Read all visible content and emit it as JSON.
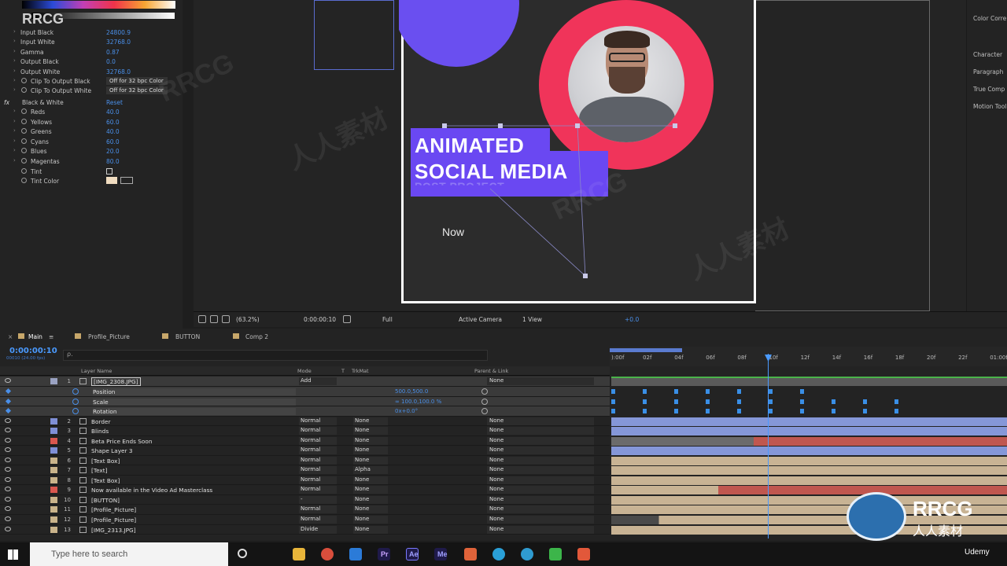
{
  "watermark": {
    "brand": "RRCG",
    "sub": "人人素材",
    "diag1": "人人素材",
    "diag2": "RRCG",
    "udemy": "Udemy"
  },
  "effects": {
    "levels_props": [
      {
        "name": "Input Black",
        "value": "24800.9"
      },
      {
        "name": "Input White",
        "value": "32768.0"
      },
      {
        "name": "Gamma",
        "value": "0.87"
      },
      {
        "name": "Output Black",
        "value": "0.0"
      },
      {
        "name": "Output White",
        "value": "32768.0"
      },
      {
        "name": "Clip To Output Black",
        "value": "Off for 32 bpc Color"
      },
      {
        "name": "Clip To Output White",
        "value": "Off for 32 bpc Color"
      }
    ],
    "bw_title": "Black & White",
    "bw_reset": "Reset",
    "bw_props": [
      {
        "name": "Reds",
        "value": "40.0"
      },
      {
        "name": "Yellows",
        "value": "60.0"
      },
      {
        "name": "Greens",
        "value": "40.0"
      },
      {
        "name": "Cyans",
        "value": "60.0"
      },
      {
        "name": "Blues",
        "value": "20.0"
      },
      {
        "name": "Magentas",
        "value": "80.0"
      },
      {
        "name": "Tint",
        "value": ""
      },
      {
        "name": "Tint Color",
        "value": ""
      }
    ]
  },
  "artwork": {
    "line1": "ANIMATED",
    "line2": "SOCIAL MEDIA",
    "line3": "POST PROJECT",
    "now": "Now"
  },
  "right_panel": {
    "color_corr": "Color Corre",
    "items": [
      "Character",
      "Paragraph",
      "True Comp",
      "Motion Tool"
    ]
  },
  "viewer_bar": {
    "zoom": "(63.2%)",
    "time": "0:00:00:10",
    "res": "Full",
    "camera": "Active Camera",
    "view": "1 View",
    "exposure": "+0.0"
  },
  "tabs": [
    "Main",
    "Profile_Picture",
    "BUTTON",
    "Comp 2"
  ],
  "timecode": "0:00:00:10",
  "timecode_sub": "00010 (24.00 fps)",
  "search_placeholder": "ρ.",
  "headers": {
    "layer": "Layer Name",
    "mode": "Mode",
    "t": "T",
    "trkmat": "TrkMat",
    "parent": "Parent & Link"
  },
  "ruler": [
    "):00f",
    "02f",
    "04f",
    "06f",
    "08f",
    "10f",
    "12f",
    "14f",
    "16f",
    "18f",
    "20f",
    "22f",
    "01:00f"
  ],
  "selected_layer": {
    "num": "1",
    "name": "[IMG_2308.JPG]",
    "mode": "Add",
    "parent": "None"
  },
  "transform": [
    {
      "name": "Position",
      "value": "500.0,500.0"
    },
    {
      "name": "Scale",
      "value": "∞ 100.0,100.0 %"
    },
    {
      "name": "Rotation",
      "value": "0x+0.0°"
    }
  ],
  "layers": [
    {
      "num": "2",
      "name": "Border",
      "mode": "Normal",
      "trk": "None",
      "parent": "None",
      "color": "#7f8fd6",
      "bar": "#8597d8"
    },
    {
      "num": "3",
      "name": "Blinds",
      "mode": "Normal",
      "trk": "None",
      "parent": "None",
      "color": "#7f8fd6",
      "bar": "#8597d8"
    },
    {
      "num": "4",
      "name": "Beta Price Ends Soon",
      "mode": "Normal",
      "trk": "None",
      "parent": "None",
      "color": "#d9574f",
      "bar": "#c0574f"
    },
    {
      "num": "5",
      "name": "Shape Layer 3",
      "mode": "Normal",
      "trk": "None",
      "parent": "None",
      "color": "#7f8fd6",
      "bar": "#8597d8"
    },
    {
      "num": "6",
      "name": "[Text Box]",
      "mode": "Normal",
      "trk": "None",
      "parent": "None",
      "color": "#c9b38a",
      "bar": "#c8b394"
    },
    {
      "num": "7",
      "name": "[Text]",
      "mode": "Normal",
      "trk": "Alpha",
      "parent": "None",
      "color": "#c9b38a",
      "bar": "#c8b394"
    },
    {
      "num": "8",
      "name": "[Text Box]",
      "mode": "Normal",
      "trk": "None",
      "parent": "None",
      "color": "#c9b38a",
      "bar": "#c8b394"
    },
    {
      "num": "9",
      "name": "Now available in the Video Ad Masterclass",
      "mode": "Normal",
      "trk": "None",
      "parent": "None",
      "color": "#d9574f",
      "bar": "#c0574f"
    },
    {
      "num": "10",
      "name": "[BUTTON]",
      "mode": "-",
      "trk": "None",
      "parent": "None",
      "color": "#c9b38a",
      "bar": "#c8b394"
    },
    {
      "num": "11",
      "name": "[Profile_Picture]",
      "mode": "Normal",
      "trk": "None",
      "parent": "None",
      "color": "#c9b38a",
      "bar": "#c8b394"
    },
    {
      "num": "12",
      "name": "[Profile_Picture]",
      "mode": "Normal",
      "trk": "None",
      "parent": "None",
      "color": "#c9b38a",
      "bar": "#c8b394"
    },
    {
      "num": "13",
      "name": "[IMG_2313.JPG]",
      "mode": "Divide",
      "trk": "None",
      "parent": "None",
      "color": "#c9b38a",
      "bar": "#c8b394"
    }
  ],
  "taskbar": {
    "search": "Type here to search",
    "apps": [
      "Pr",
      "Ae",
      "Me"
    ]
  }
}
